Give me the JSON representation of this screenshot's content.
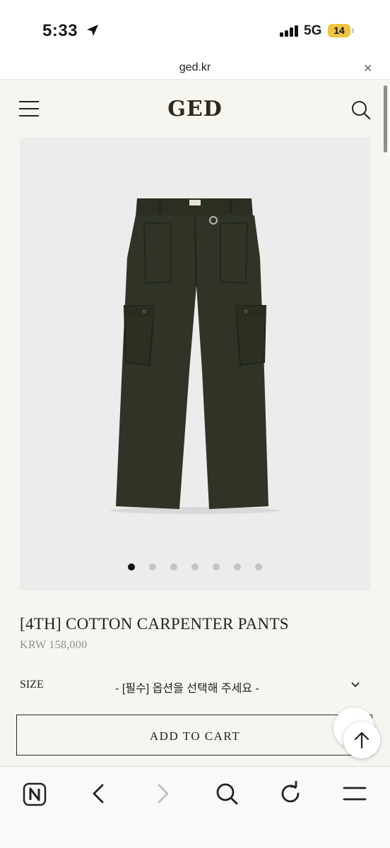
{
  "status_bar": {
    "time": "5:33",
    "network": "5G",
    "battery": "14"
  },
  "browser": {
    "url": "ged.kr"
  },
  "header": {
    "logo": "GED"
  },
  "product": {
    "title": "[4TH] COTTON CARPENTER PANTS",
    "price": "KRW 158,000",
    "image_count": 7,
    "active_image_index": 0,
    "size_label": "SIZE",
    "size_placeholder": "- [필수] 옵션을 선택해 주세요 -",
    "add_to_cart": "ADD TO CART"
  },
  "colors": {
    "pants": "#2f3426",
    "page_bg": "#f7f5ef",
    "image_bg": "#ececec",
    "battery": "#f0c33c"
  },
  "toolbar_icons": [
    "naver-home-icon",
    "back-icon",
    "forward-icon",
    "search-icon",
    "reload-icon",
    "menu-icon"
  ]
}
